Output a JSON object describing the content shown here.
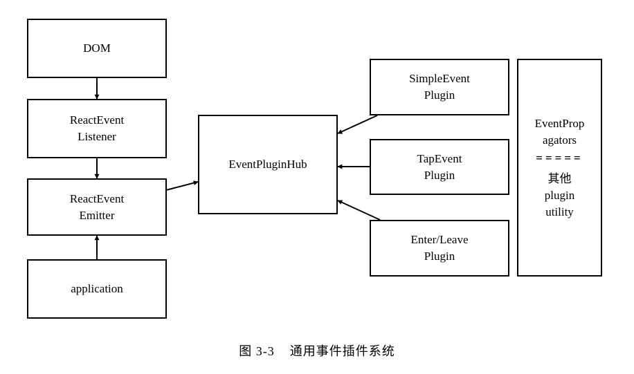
{
  "diagram": {
    "dom": "DOM",
    "listener": {
      "line1": "ReactEvent",
      "line2": "Listener"
    },
    "emitter": {
      "line1": "ReactEvent",
      "line2": "Emitter"
    },
    "application": "application",
    "hub": "EventPluginHub",
    "simple_plugin": {
      "line1": "SimpleEvent",
      "line2": "Plugin"
    },
    "tap_plugin": {
      "line1": "TapEvent",
      "line2": "Plugin"
    },
    "enterleave_plugin": {
      "line1": "Enter/Leave",
      "line2": "Plugin"
    },
    "utility": {
      "line1": "EventProp",
      "line2": "agators",
      "separator": "=====",
      "line3": "其他",
      "line4": "plugin",
      "line5": "utility"
    }
  },
  "caption": "图 3-3    通用事件插件系统"
}
